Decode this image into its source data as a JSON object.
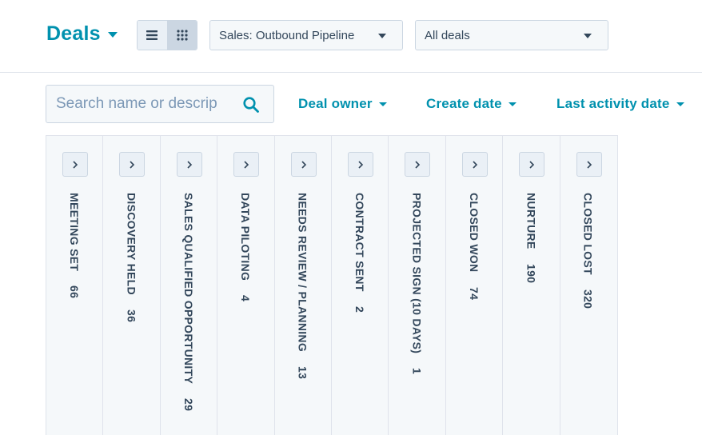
{
  "header": {
    "title": "Deals",
    "pipeline_select": "Sales: Outbound Pipeline",
    "view_select": "All deals"
  },
  "toolbar": {
    "search_placeholder": "Search name or descrip",
    "filters": {
      "deal_owner": "Deal owner",
      "create_date": "Create date",
      "last_activity_date": "Last activity date"
    }
  },
  "stages": [
    {
      "label": "MEETING SET",
      "count": "66"
    },
    {
      "label": "DISCOVERY HELD",
      "count": "36"
    },
    {
      "label": "SALES QUALIFIED OPPORTUNITY",
      "count": "29"
    },
    {
      "label": "DATA PILOTING",
      "count": "4"
    },
    {
      "label": "NEEDS REVIEW / PLANNING",
      "count": "13"
    },
    {
      "label": "CONTRACT SENT",
      "count": "2"
    },
    {
      "label": "PROJECTED SIGN (10 DAYS)",
      "count": "1"
    },
    {
      "label": "CLOSED WON",
      "count": "74"
    },
    {
      "label": "NURTURE",
      "count": "190"
    },
    {
      "label": "CLOSED LOST",
      "count": "320"
    }
  ],
  "icons": {
    "list_view": "list-icon",
    "board_view": "grid-icon",
    "search": "search-icon",
    "expand": "chevron-right-icon"
  },
  "colors": {
    "accent": "#0091ae",
    "text": "#33475b",
    "border": "#cbd6e2",
    "background_light": "#f5f8fa"
  }
}
